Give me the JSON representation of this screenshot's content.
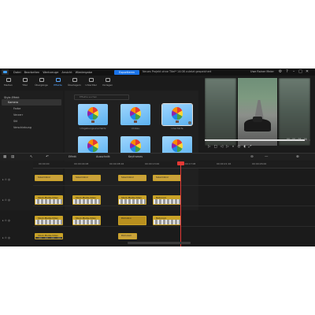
{
  "titlebar": {
    "menu": [
      "Datei",
      "Bearbeiten",
      "Werkzeuge",
      "Ansicht",
      "Wiedergabe"
    ],
    "export_label": "Exportieren",
    "project_title": "Neues Projekt ohne Titel* 14:08 zuletzt gespeichert",
    "user_name": "Uwe Rainer Meier"
  },
  "media_tabs": [
    "Medien",
    "Titel",
    "Übergänge",
    "Effekte",
    "Überlagern",
    "Untertitel",
    "Vorlagen"
  ],
  "tree": {
    "header": "Style-Effekt",
    "items": [
      "Kamera",
      "Farbe",
      "Verzerr",
      "Stil",
      "Verschiebung"
    ]
  },
  "grid": {
    "search_placeholder": "Effekte suchen",
    "items": [
      "Umgebungsunschärfe",
      "Umbau",
      "Unschärfe"
    ]
  },
  "preview": {
    "timecode": "00 : 00 : 08 : 16",
    "progress": 0.95
  },
  "timeline": {
    "toolbar": [
      "Effekt",
      "Ausschnitt",
      "Keyframes"
    ],
    "ruler": [
      "00:00:00",
      "00:00:04:08",
      "00:00:08:16",
      "00:00:13:00",
      "00:00:17:08",
      "00:00:21:16",
      "00:00:26:00"
    ],
    "clips": {
      "title": "Solarmikrol",
      "video_a": "Stock-Media-Video",
      "video_b": "Motorrad",
      "fx_a": "Pomolino",
      "fx_b": "Pomulum"
    }
  }
}
